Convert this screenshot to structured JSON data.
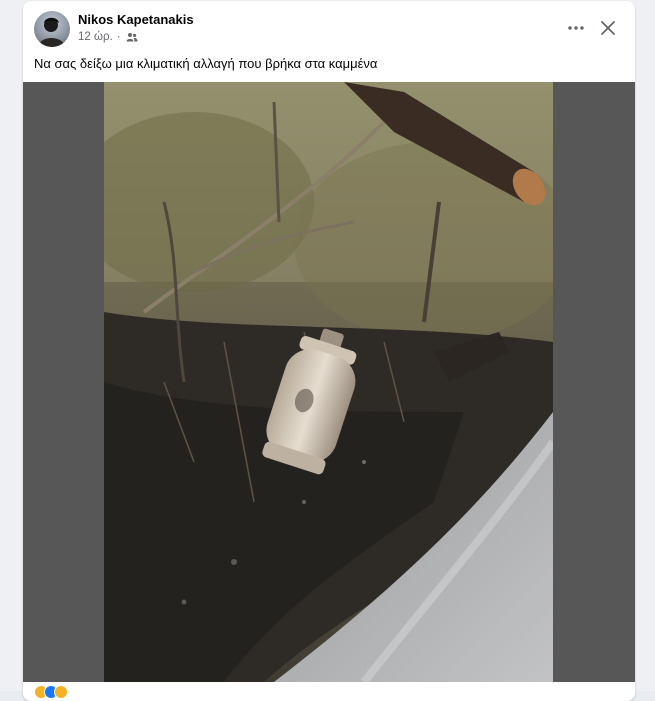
{
  "post": {
    "author": "Nikos Kapetanakis",
    "time": "12 ώρ.",
    "separator": "·",
    "audience_icon": "friends-icon",
    "text": "Να σας δείξω μια κλιματική αλλαγή που βρήκα στα καμμένα"
  },
  "header": {
    "more_icon": "more-options-icon",
    "close_icon": "close-icon"
  },
  "media": {
    "photo_description_icon": "photo"
  },
  "reactions": {
    "icons": [
      "haha-icon",
      "like-icon",
      "wow-icon"
    ],
    "colors": [
      "#f7b125",
      "#1877f2",
      "#f7b125"
    ]
  },
  "colors": {
    "background": "#eef0f3",
    "card": "#ffffff",
    "media_backdrop": "#575757",
    "primary_text": "#050505",
    "secondary_text": "#65676b"
  }
}
